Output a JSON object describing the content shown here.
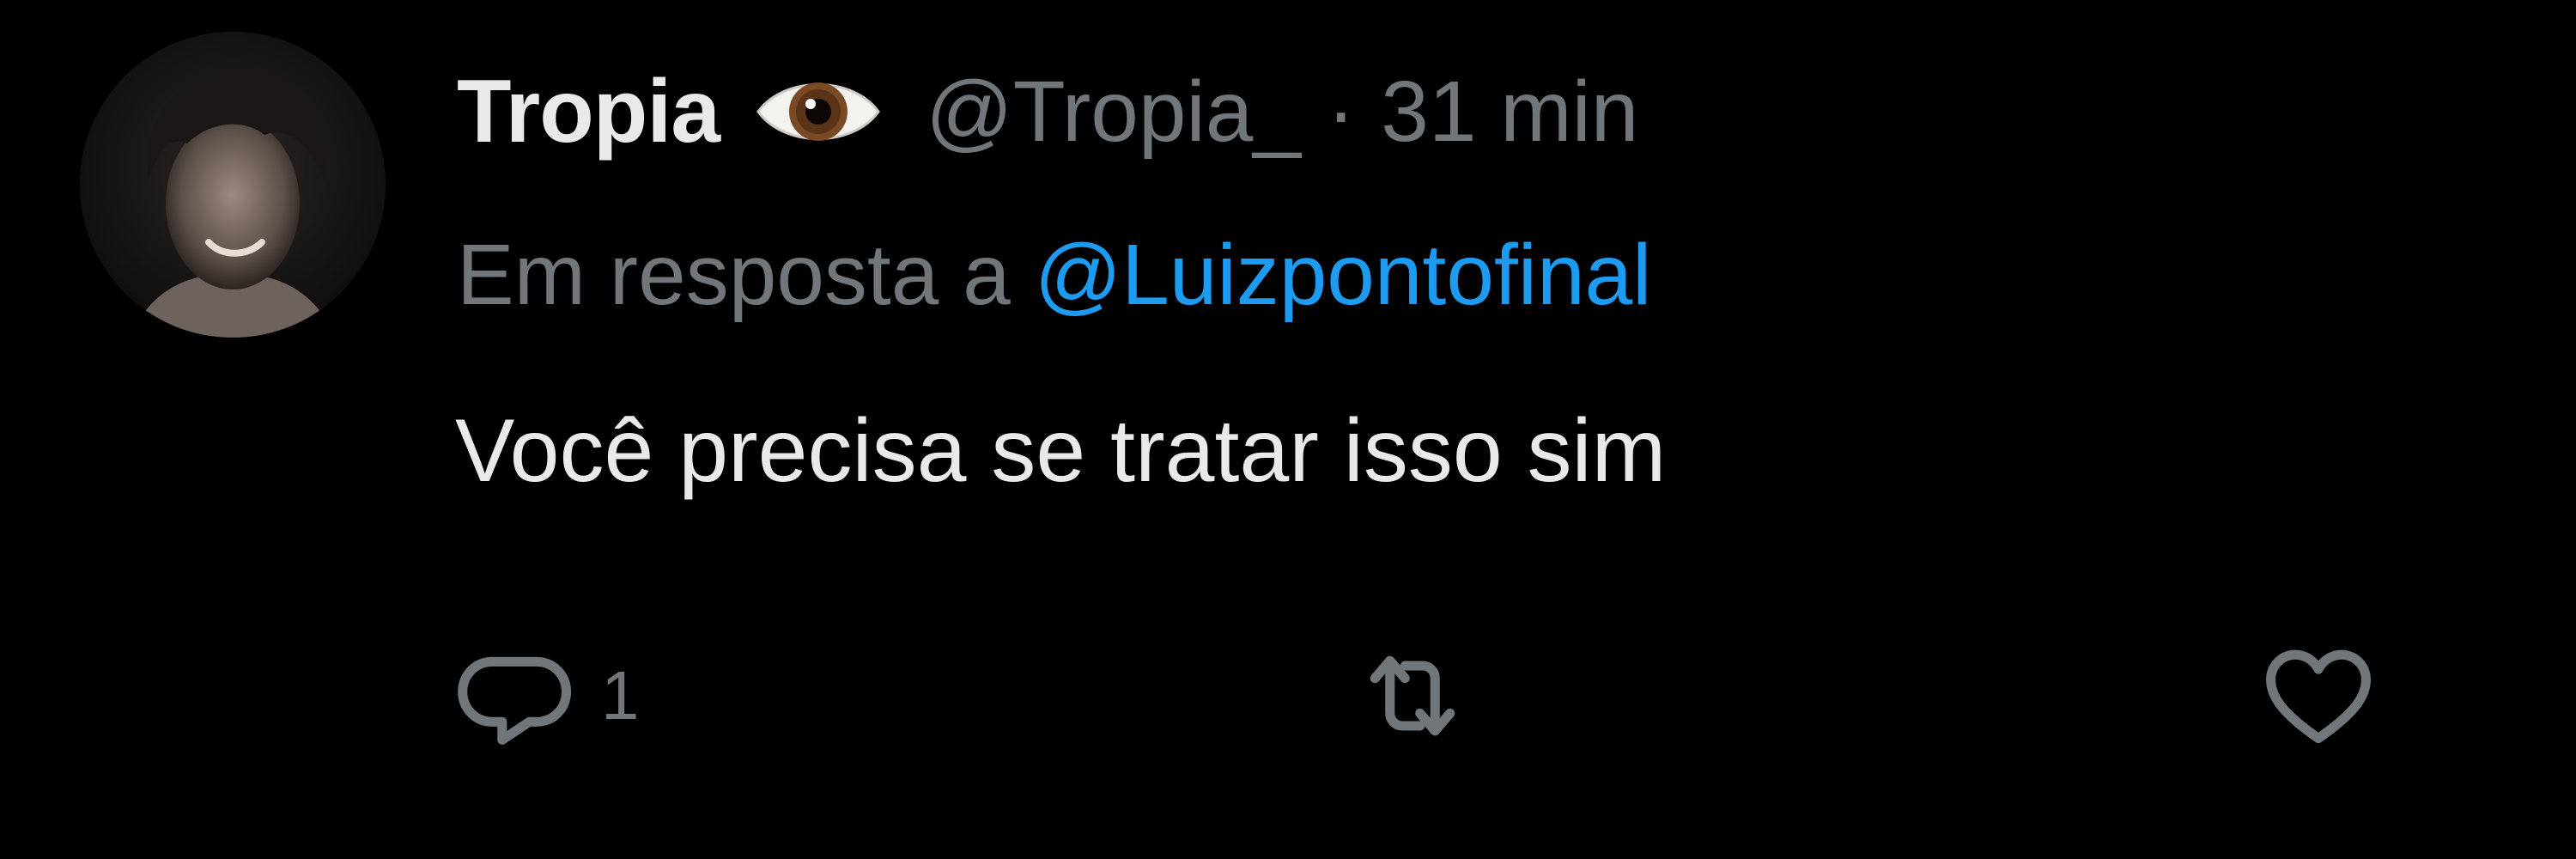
{
  "tweet": {
    "author": {
      "display_name": "Tropia",
      "name_emoji_icon": "eye-icon",
      "handle": "@Tropia_",
      "separator": "·",
      "time": "31 min",
      "avatar_icon": "avatar-photo"
    },
    "reply": {
      "prefix": "Em resposta a",
      "target": "@Luizpontofinal"
    },
    "text": "Você precisa se tratar isso sim",
    "actions": {
      "reply": {
        "icon": "reply-bubble-icon",
        "count": "1"
      },
      "retweet": {
        "icon": "retweet-icon",
        "count": ""
      },
      "like": {
        "icon": "heart-icon",
        "count": ""
      }
    }
  },
  "colors": {
    "background": "#000000",
    "primary_text": "#e7e9ea",
    "secondary_text": "#71767b",
    "link": "#1d9bf0"
  }
}
